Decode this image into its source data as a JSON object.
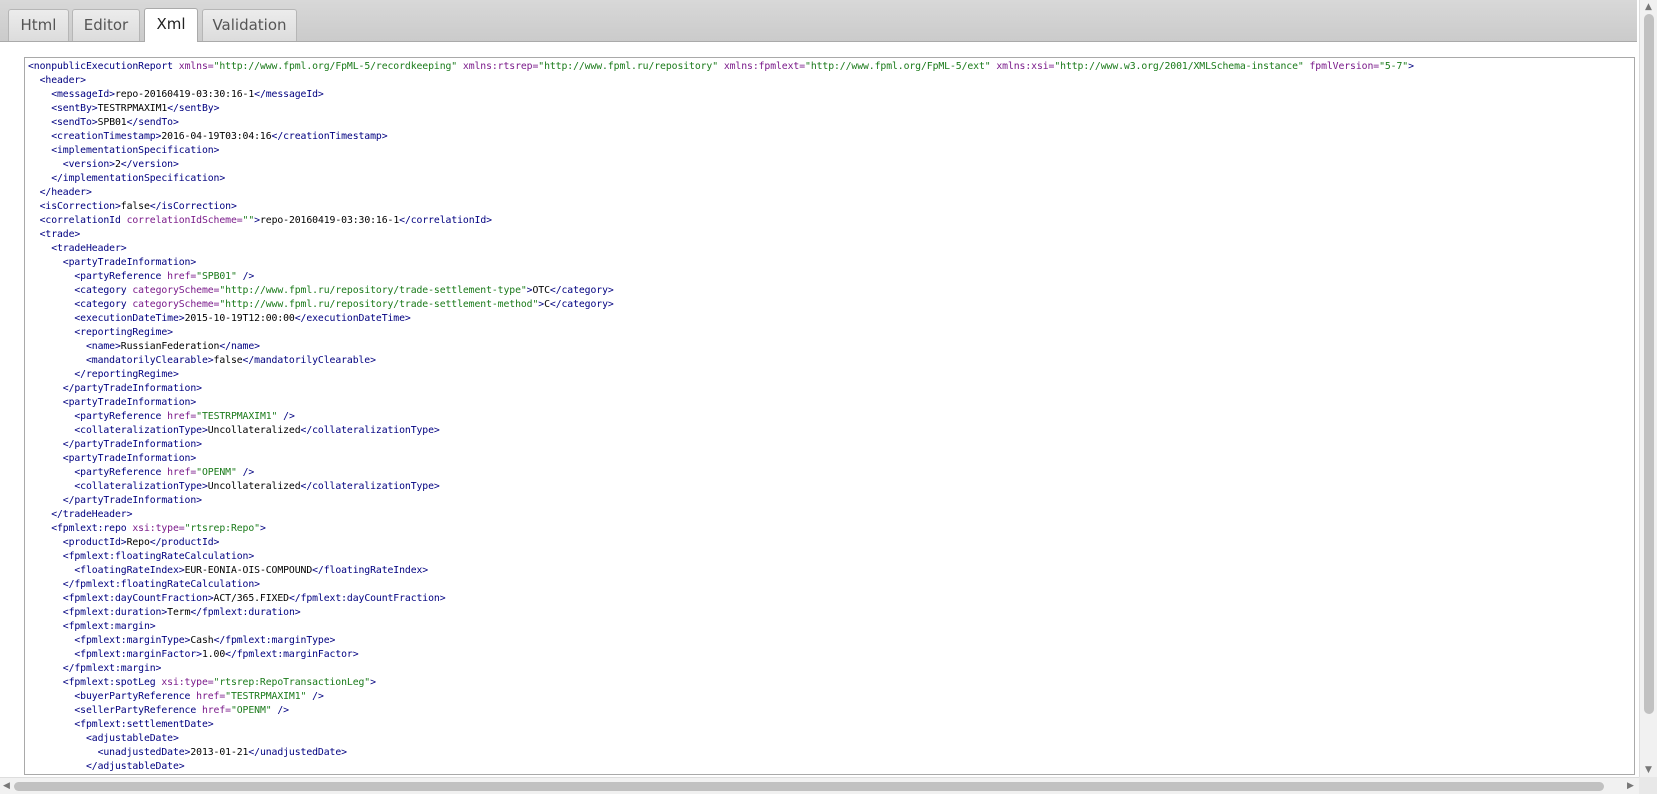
{
  "tabs": [
    {
      "label": "Html"
    },
    {
      "label": "Editor"
    },
    {
      "label": "Xml"
    },
    {
      "label": "Validation"
    }
  ],
  "active_tab": "Xml",
  "scroll_icons": {
    "up": "scroll-up-icon",
    "down": "scroll-down-icon",
    "left": "scroll-left-icon",
    "right": "scroll-right-icon"
  },
  "xml_lines": [
    [
      [
        "t",
        "<nonpublicExecutionReport "
      ],
      [
        "a",
        "xmlns="
      ],
      [
        "v",
        "\"http://www.fpml.org/FpML-5/recordkeeping\""
      ],
      [
        "a",
        " xmlns:rtsrep="
      ],
      [
        "v",
        "\"http://www.fpml.ru/repository\""
      ],
      [
        "a",
        " xmlns:fpmlext="
      ],
      [
        "v",
        "\"http://www.fpml.org/FpML-5/ext\""
      ],
      [
        "a",
        " xmlns:xsi="
      ],
      [
        "v",
        "\"http://www.w3.org/2001/XMLSchema-instance\""
      ],
      [
        "a",
        " fpmlVersion="
      ],
      [
        "v",
        "\"5-7\""
      ],
      [
        "t",
        ">"
      ]
    ],
    [
      [
        "t",
        "  <header>"
      ]
    ],
    [
      [
        "t",
        "    <messageId>"
      ],
      [
        "x",
        "repo-20160419-03:30:16-1"
      ],
      [
        "t",
        "</messageId>"
      ]
    ],
    [
      [
        "t",
        "    <sentBy>"
      ],
      [
        "x",
        "TESTRPMAXIM1"
      ],
      [
        "t",
        "</sentBy>"
      ]
    ],
    [
      [
        "t",
        "    <sendTo>"
      ],
      [
        "x",
        "SPB01"
      ],
      [
        "t",
        "</sendTo>"
      ]
    ],
    [
      [
        "t",
        "    <creationTimestamp>"
      ],
      [
        "x",
        "2016-04-19T03:04:16"
      ],
      [
        "t",
        "</creationTimestamp>"
      ]
    ],
    [
      [
        "t",
        "    <implementationSpecification>"
      ]
    ],
    [
      [
        "t",
        "      <version>"
      ],
      [
        "x",
        "2"
      ],
      [
        "t",
        "</version>"
      ]
    ],
    [
      [
        "t",
        "    </implementationSpecification>"
      ]
    ],
    [
      [
        "t",
        "  </header>"
      ]
    ],
    [
      [
        "t",
        "  <isCorrection>"
      ],
      [
        "x",
        "false"
      ],
      [
        "t",
        "</isCorrection>"
      ]
    ],
    [
      [
        "t",
        "  <correlationId "
      ],
      [
        "a",
        "correlationIdScheme="
      ],
      [
        "v",
        "\"\""
      ],
      [
        "t",
        ">"
      ],
      [
        "x",
        "repo-20160419-03:30:16-1"
      ],
      [
        "t",
        "</correlationId>"
      ]
    ],
    [
      [
        "t",
        "  <trade>"
      ]
    ],
    [
      [
        "t",
        "    <tradeHeader>"
      ]
    ],
    [
      [
        "t",
        "      <partyTradeInformation>"
      ]
    ],
    [
      [
        "t",
        "        <partyReference "
      ],
      [
        "a",
        "href="
      ],
      [
        "v",
        "\"SPB01\""
      ],
      [
        "t",
        " />"
      ]
    ],
    [
      [
        "t",
        "        <category "
      ],
      [
        "a",
        "categoryScheme="
      ],
      [
        "v",
        "\"http://www.fpml.ru/repository/trade-settlement-type\""
      ],
      [
        "t",
        ">"
      ],
      [
        "x",
        "OTC"
      ],
      [
        "t",
        "</category>"
      ]
    ],
    [
      [
        "t",
        "        <category "
      ],
      [
        "a",
        "categoryScheme="
      ],
      [
        "v",
        "\"http://www.fpml.ru/repository/trade-settlement-method\""
      ],
      [
        "t",
        ">"
      ],
      [
        "x",
        "C"
      ],
      [
        "t",
        "</category>"
      ]
    ],
    [
      [
        "t",
        "        <executionDateTime>"
      ],
      [
        "x",
        "2015-10-19T12:00:00"
      ],
      [
        "t",
        "</executionDateTime>"
      ]
    ],
    [
      [
        "t",
        "        <reportingRegime>"
      ]
    ],
    [
      [
        "t",
        "          <name>"
      ],
      [
        "x",
        "RussianFederation"
      ],
      [
        "t",
        "</name>"
      ]
    ],
    [
      [
        "t",
        "          <mandatorilyClearable>"
      ],
      [
        "x",
        "false"
      ],
      [
        "t",
        "</mandatorilyClearable>"
      ]
    ],
    [
      [
        "t",
        "        </reportingRegime>"
      ]
    ],
    [
      [
        "t",
        "      </partyTradeInformation>"
      ]
    ],
    [
      [
        "t",
        "      <partyTradeInformation>"
      ]
    ],
    [
      [
        "t",
        "        <partyReference "
      ],
      [
        "a",
        "href="
      ],
      [
        "v",
        "\"TESTRPMAXIM1\""
      ],
      [
        "t",
        " />"
      ]
    ],
    [
      [
        "t",
        "        <collateralizationType>"
      ],
      [
        "x",
        "Uncollateralized"
      ],
      [
        "t",
        "</collateralizationType>"
      ]
    ],
    [
      [
        "t",
        "      </partyTradeInformation>"
      ]
    ],
    [
      [
        "t",
        "      <partyTradeInformation>"
      ]
    ],
    [
      [
        "t",
        "        <partyReference "
      ],
      [
        "a",
        "href="
      ],
      [
        "v",
        "\"OPENM\""
      ],
      [
        "t",
        " />"
      ]
    ],
    [
      [
        "t",
        "        <collateralizationType>"
      ],
      [
        "x",
        "Uncollateralized"
      ],
      [
        "t",
        "</collateralizationType>"
      ]
    ],
    [
      [
        "t",
        "      </partyTradeInformation>"
      ]
    ],
    [
      [
        "t",
        "    </tradeHeader>"
      ]
    ],
    [
      [
        "t",
        "    <fpmlext:repo "
      ],
      [
        "a",
        "xsi:type="
      ],
      [
        "v",
        "\"rtsrep:Repo\""
      ],
      [
        "t",
        ">"
      ]
    ],
    [
      [
        "t",
        "      <productId>"
      ],
      [
        "x",
        "Repo"
      ],
      [
        "t",
        "</productId>"
      ]
    ],
    [
      [
        "t",
        "      <fpmlext:floatingRateCalculation>"
      ]
    ],
    [
      [
        "t",
        "        <floatingRateIndex>"
      ],
      [
        "x",
        "EUR-EONIA-OIS-COMPOUND"
      ],
      [
        "t",
        "</floatingRateIndex>"
      ]
    ],
    [
      [
        "t",
        "      </fpmlext:floatingRateCalculation>"
      ]
    ],
    [
      [
        "t",
        "      <fpmlext:dayCountFraction>"
      ],
      [
        "x",
        "ACT/365.FIXED"
      ],
      [
        "t",
        "</fpmlext:dayCountFraction>"
      ]
    ],
    [
      [
        "t",
        "      <fpmlext:duration>"
      ],
      [
        "x",
        "Term"
      ],
      [
        "t",
        "</fpmlext:duration>"
      ]
    ],
    [
      [
        "t",
        "      <fpmlext:margin>"
      ]
    ],
    [
      [
        "t",
        "        <fpmlext:marginType>"
      ],
      [
        "x",
        "Cash"
      ],
      [
        "t",
        "</fpmlext:marginType>"
      ]
    ],
    [
      [
        "t",
        "        <fpmlext:marginFactor>"
      ],
      [
        "x",
        "1.00"
      ],
      [
        "t",
        "</fpmlext:marginFactor>"
      ]
    ],
    [
      [
        "t",
        "      </fpmlext:margin>"
      ]
    ],
    [
      [
        "t",
        "      <fpmlext:spotLeg "
      ],
      [
        "a",
        "xsi:type="
      ],
      [
        "v",
        "\"rtsrep:RepoTransactionLeg\""
      ],
      [
        "t",
        ">"
      ]
    ],
    [
      [
        "t",
        "        <buyerPartyReference "
      ],
      [
        "a",
        "href="
      ],
      [
        "v",
        "\"TESTRPMAXIM1\""
      ],
      [
        "t",
        " />"
      ]
    ],
    [
      [
        "t",
        "        <sellerPartyReference "
      ],
      [
        "a",
        "href="
      ],
      [
        "v",
        "\"OPENM\""
      ],
      [
        "t",
        " />"
      ]
    ],
    [
      [
        "t",
        "        <fpmlext:settlementDate>"
      ]
    ],
    [
      [
        "t",
        "          <adjustableDate>"
      ]
    ],
    [
      [
        "t",
        "            <unadjustedDate>"
      ],
      [
        "x",
        "2013-01-21"
      ],
      [
        "t",
        "</unadjustedDate>"
      ]
    ],
    [
      [
        "t",
        "          </adjustableDate>"
      ]
    ]
  ]
}
